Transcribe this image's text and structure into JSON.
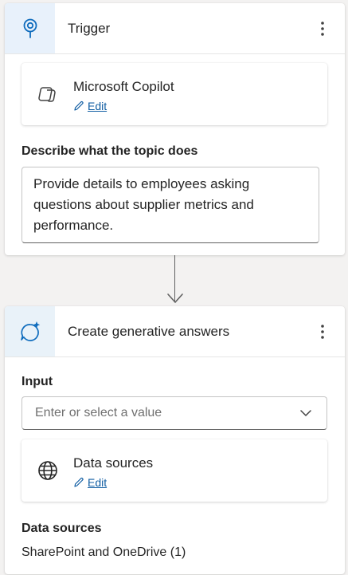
{
  "trigger": {
    "title": "Trigger",
    "source_card": {
      "title": "Microsoft Copilot",
      "edit_label": "Edit"
    },
    "description_label": "Describe what the topic does",
    "description_value": "Provide details to employees asking questions about supplier metrics and performance."
  },
  "generative": {
    "title": "Create generative answers",
    "input_label": "Input",
    "input_placeholder": "Enter or select a value",
    "data_sources_card": {
      "title": "Data sources",
      "edit_label": "Edit"
    },
    "data_sources_label": "Data sources",
    "data_sources_value": "SharePoint and OneDrive (1)"
  },
  "colors": {
    "accent": "#0f6cbd",
    "link": "#115ea3",
    "header_icon_bg": "#e8f1fb"
  },
  "icons": {
    "trigger": "location-pin-icon",
    "copilot": "copilot-icon",
    "generative": "sparkle-chat-icon",
    "globe": "globe-icon",
    "more": "more-vertical-icon",
    "edit": "pencil-icon",
    "dropdown": "chevron-down-icon"
  }
}
